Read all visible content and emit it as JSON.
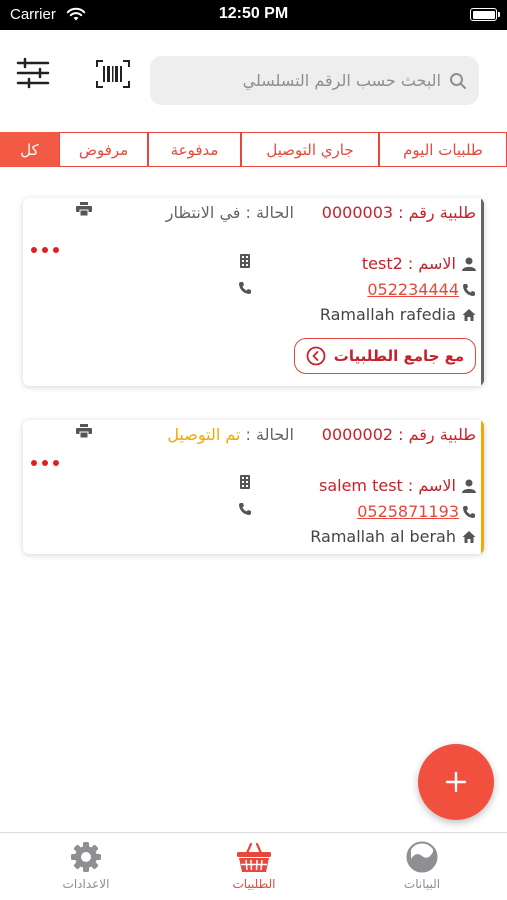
{
  "status_bar": {
    "carrier": "Carrier",
    "time": "12:50 PM"
  },
  "search": {
    "placeholder": "البحث حسب الرقم التسلسلي"
  },
  "filters": [
    {
      "label": "طلبيات اليوم",
      "active": false
    },
    {
      "label": "جاري التوصيل",
      "active": false
    },
    {
      "label": "مدفوعة",
      "active": false
    },
    {
      "label": "مرفوض",
      "active": false
    },
    {
      "label": "كل",
      "active": true
    }
  ],
  "orders": [
    {
      "order_label": "طلبية رقم : 0000003",
      "status_prefix": "الحالة : ",
      "status": "في الانتظار",
      "status_color": "#666666",
      "accent_color": "#666666",
      "name_label": "الاسم : test2",
      "phone": "052234444",
      "address": "Ramallah rafedia",
      "action_label": "مع جامع الطلبيات"
    },
    {
      "order_label": "طلبية رقم : 0000002",
      "status_prefix": "الحالة : ",
      "status": "تم التوصيل",
      "status_color": "#f2a900",
      "accent_color": "#f2a900",
      "name_label": "الاسم : salem test",
      "phone": "0525871193",
      "address": "Ramallah al berah"
    }
  ],
  "tab_bar": [
    {
      "label": "الاعدادات",
      "icon": "gear-icon",
      "active": false
    },
    {
      "label": "الطلبيات",
      "icon": "basket-icon",
      "active": true
    },
    {
      "label": "البيانات",
      "icon": "chart-circle-icon",
      "active": false
    }
  ],
  "colors": {
    "accent": "#f2503f",
    "red_text": "#c9202a",
    "delivered": "#f2a900"
  }
}
